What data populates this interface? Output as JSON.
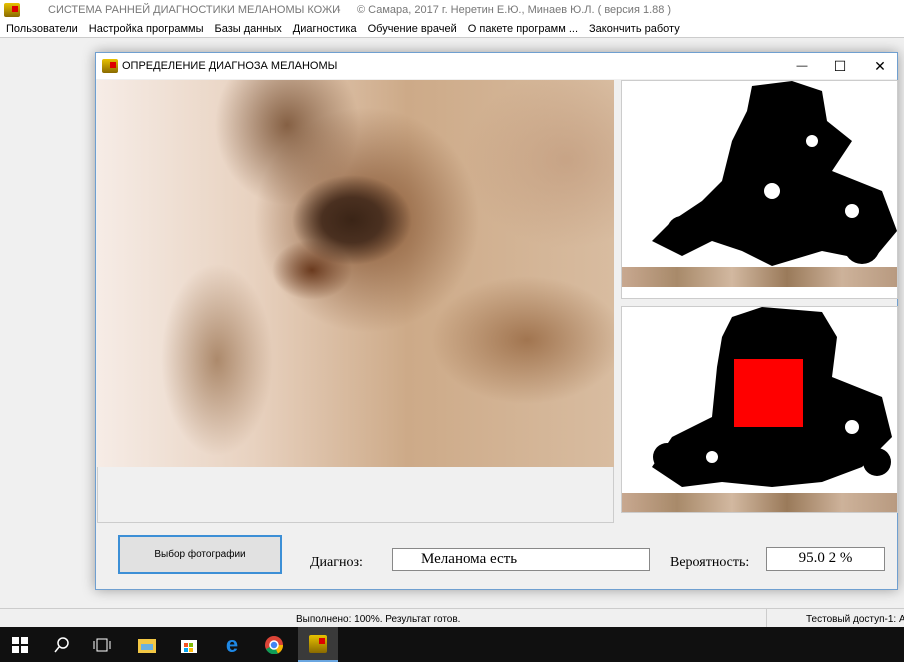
{
  "app": {
    "title": "СИСТЕМА РАННЕЙ ДИАГНОСТИКИ МЕЛАНОМЫ КОЖИ",
    "separator": "-",
    "copyright": "© Самара, 2017 г. Неретин Е.Ю., Минаев Ю.Л.  ( версия 1.88 )"
  },
  "menu": [
    "Пользователи",
    "Настройка программы",
    "Базы данных",
    "Диагностика",
    "Обучение врачей",
    "О пакете программ ...",
    "Закончить работу"
  ],
  "window": {
    "title": "ОПРЕДЕЛЕНИЕ ДИАГНОЗА МЕЛАНОМЫ",
    "minimize": "—",
    "maximize": "☐",
    "close": "✕"
  },
  "controls": {
    "select_photo": "Выбор фотографии",
    "diagnosis_label": "Диагноз:",
    "diagnosis_value": "Меланома есть",
    "probability_label": "Вероятность:",
    "probability_value": "95.0 2 %"
  },
  "status": {
    "progress": "Выполнено:  100%. Результат готов.",
    "access": "Тестовый доступ-1: А"
  },
  "colors": {
    "marker": "#ff0000",
    "accent": "#3c8fd6"
  }
}
